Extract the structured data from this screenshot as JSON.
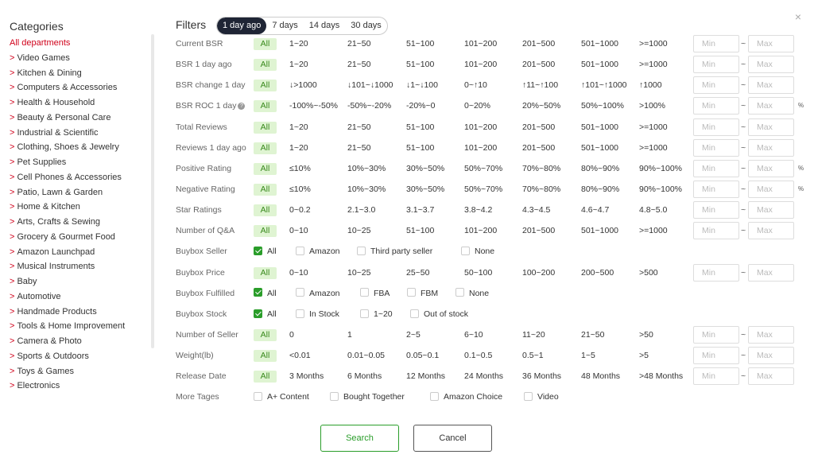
{
  "sidebar": {
    "title": "Categories",
    "items": [
      {
        "label": "All departments",
        "active": true
      },
      {
        "label": "Video Games"
      },
      {
        "label": "Kitchen & Dining"
      },
      {
        "label": "Computers & Accessories"
      },
      {
        "label": "Health & Household"
      },
      {
        "label": "Beauty & Personal Care"
      },
      {
        "label": "Industrial & Scientific"
      },
      {
        "label": "Clothing, Shoes & Jewelry"
      },
      {
        "label": "Pet Supplies"
      },
      {
        "label": "Cell Phones & Accessories"
      },
      {
        "label": "Patio, Lawn & Garden"
      },
      {
        "label": "Home & Kitchen"
      },
      {
        "label": "Arts, Crafts & Sewing"
      },
      {
        "label": "Grocery & Gourmet Food"
      },
      {
        "label": "Amazon Launchpad"
      },
      {
        "label": "Musical Instruments"
      },
      {
        "label": "Baby"
      },
      {
        "label": "Automotive"
      },
      {
        "label": "Handmade Products"
      },
      {
        "label": "Tools & Home Improvement"
      },
      {
        "label": "Camera & Photo"
      },
      {
        "label": "Sports & Outdoors"
      },
      {
        "label": "Toys & Games"
      },
      {
        "label": "Electronics"
      }
    ]
  },
  "filters": {
    "title": "Filters",
    "periods": [
      {
        "label": "1 day ago",
        "active": true
      },
      {
        "label": "7 days"
      },
      {
        "label": "14 days"
      },
      {
        "label": "30 days"
      }
    ],
    "close_icon": "×",
    "min_placeholder": "Min",
    "max_placeholder": "Max",
    "tilde": "~",
    "rows": [
      {
        "label": "Current BSR",
        "type": "pills",
        "all": "All",
        "options": [
          "1~20",
          "21~50",
          "51~100",
          "101~200",
          "201~500",
          "501~1000",
          ">=1000"
        ],
        "range": true,
        "unit": ""
      },
      {
        "label": "BSR 1 day ago",
        "type": "pills",
        "all": "All",
        "options": [
          "1~20",
          "21~50",
          "51~100",
          "101~200",
          "201~500",
          "501~1000",
          ">=1000"
        ],
        "range": true,
        "unit": ""
      },
      {
        "label": "BSR change 1 day",
        "type": "pills",
        "all": "All",
        "options": [
          "↓>1000",
          "↓101~↓1000",
          "↓1~↓100",
          "0~↑10",
          "↑11~↑100",
          "↑101~↑1000",
          "↑1000"
        ],
        "range": true,
        "unit": ""
      },
      {
        "label": "BSR ROC 1 day",
        "help": "?",
        "type": "pills",
        "all": "All",
        "options": [
          "-100%~-50%",
          "-50%~-20%",
          "-20%~0",
          "0~20%",
          "20%~50%",
          "50%~100%",
          ">100%"
        ],
        "range": true,
        "unit": "%"
      },
      {
        "label": "Total Reviews",
        "type": "pills",
        "all": "All",
        "options": [
          "1~20",
          "21~50",
          "51~100",
          "101~200",
          "201~500",
          "501~1000",
          ">=1000"
        ],
        "range": true,
        "unit": ""
      },
      {
        "label": "Reviews 1 day ago",
        "type": "pills",
        "all": "All",
        "options": [
          "1~20",
          "21~50",
          "51~100",
          "101~200",
          "201~500",
          "501~1000",
          ">=1000"
        ],
        "range": true,
        "unit": ""
      },
      {
        "label": "Positive Rating",
        "type": "pills",
        "all": "All",
        "options": [
          "≤10%",
          "10%~30%",
          "30%~50%",
          "50%~70%",
          "70%~80%",
          "80%~90%",
          "90%~100%"
        ],
        "range": true,
        "unit": "%"
      },
      {
        "label": "Negative Rating",
        "type": "pills",
        "all": "All",
        "options": [
          "≤10%",
          "10%~30%",
          "30%~50%",
          "50%~70%",
          "70%~80%",
          "80%~90%",
          "90%~100%"
        ],
        "range": true,
        "unit": "%"
      },
      {
        "label": "Star Ratings",
        "type": "pills",
        "all": "All",
        "options": [
          "0~0.2",
          "2.1~3.0",
          "3.1~3.7",
          "3.8~4.2",
          "4.3~4.5",
          "4.6~4.7",
          "4.8~5.0"
        ],
        "range": true,
        "unit": ""
      },
      {
        "label": "Number of Q&A",
        "type": "pills",
        "all": "All",
        "options": [
          "0~10",
          "10~25",
          "51~100",
          "101~200",
          "201~500",
          "501~1000",
          ">=1000"
        ],
        "range": true,
        "unit": ""
      },
      {
        "label": "Buybox Seller",
        "type": "checks",
        "checks": [
          {
            "label": "All",
            "checked": true
          },
          {
            "label": "Amazon"
          },
          {
            "label": "Third party seller"
          },
          {
            "label": "None"
          }
        ]
      },
      {
        "label": "Buybox Price",
        "type": "pills",
        "all": "All",
        "options": [
          "0~10",
          "10~25",
          "25~50",
          "50~100",
          "100~200",
          "200~500",
          ">500"
        ],
        "range": true,
        "unit": ""
      },
      {
        "label": "Buybox Fulfilled",
        "type": "checks",
        "checks": [
          {
            "label": "All",
            "checked": true
          },
          {
            "label": "Amazon"
          },
          {
            "label": "FBA"
          },
          {
            "label": "FBM"
          },
          {
            "label": "None"
          }
        ]
      },
      {
        "label": "Buybox Stock",
        "type": "checks",
        "checks": [
          {
            "label": "All",
            "checked": true
          },
          {
            "label": "In Stock"
          },
          {
            "label": "1~20"
          },
          {
            "label": "Out of stock"
          }
        ]
      },
      {
        "label": "Number of Seller",
        "type": "pills",
        "all": "All",
        "options": [
          "0",
          "1",
          "2~5",
          "6~10",
          "11~20",
          "21~50",
          ">50"
        ],
        "range": true,
        "unit": ""
      },
      {
        "label": "Weight(lb)",
        "type": "pills",
        "all": "All",
        "options": [
          "<0.01",
          "0.01~0.05",
          "0.05~0.1",
          "0.1~0.5",
          "0.5~1",
          "1~5",
          ">5"
        ],
        "range": true,
        "unit": ""
      },
      {
        "label": "Release Date",
        "type": "pills",
        "all": "All",
        "options": [
          "3 Months",
          "6 Months",
          "12 Months",
          "24 Months",
          "36 Months",
          "48 Months",
          ">48 Months"
        ],
        "range": true,
        "unit": ""
      },
      {
        "label": "More Tages",
        "type": "checks",
        "checks": [
          {
            "label": "A+ Content"
          },
          {
            "label": "Bought Together"
          },
          {
            "label": "Amazon Choice"
          },
          {
            "label": "Video"
          }
        ]
      }
    ]
  },
  "buttons": {
    "search": "Search",
    "cancel": "Cancel"
  },
  "colors": {
    "accent_red": "#d0021b",
    "accent_green": "#2a9d2a",
    "pill_bg": "#dff4d2",
    "dark": "#1f2535"
  }
}
